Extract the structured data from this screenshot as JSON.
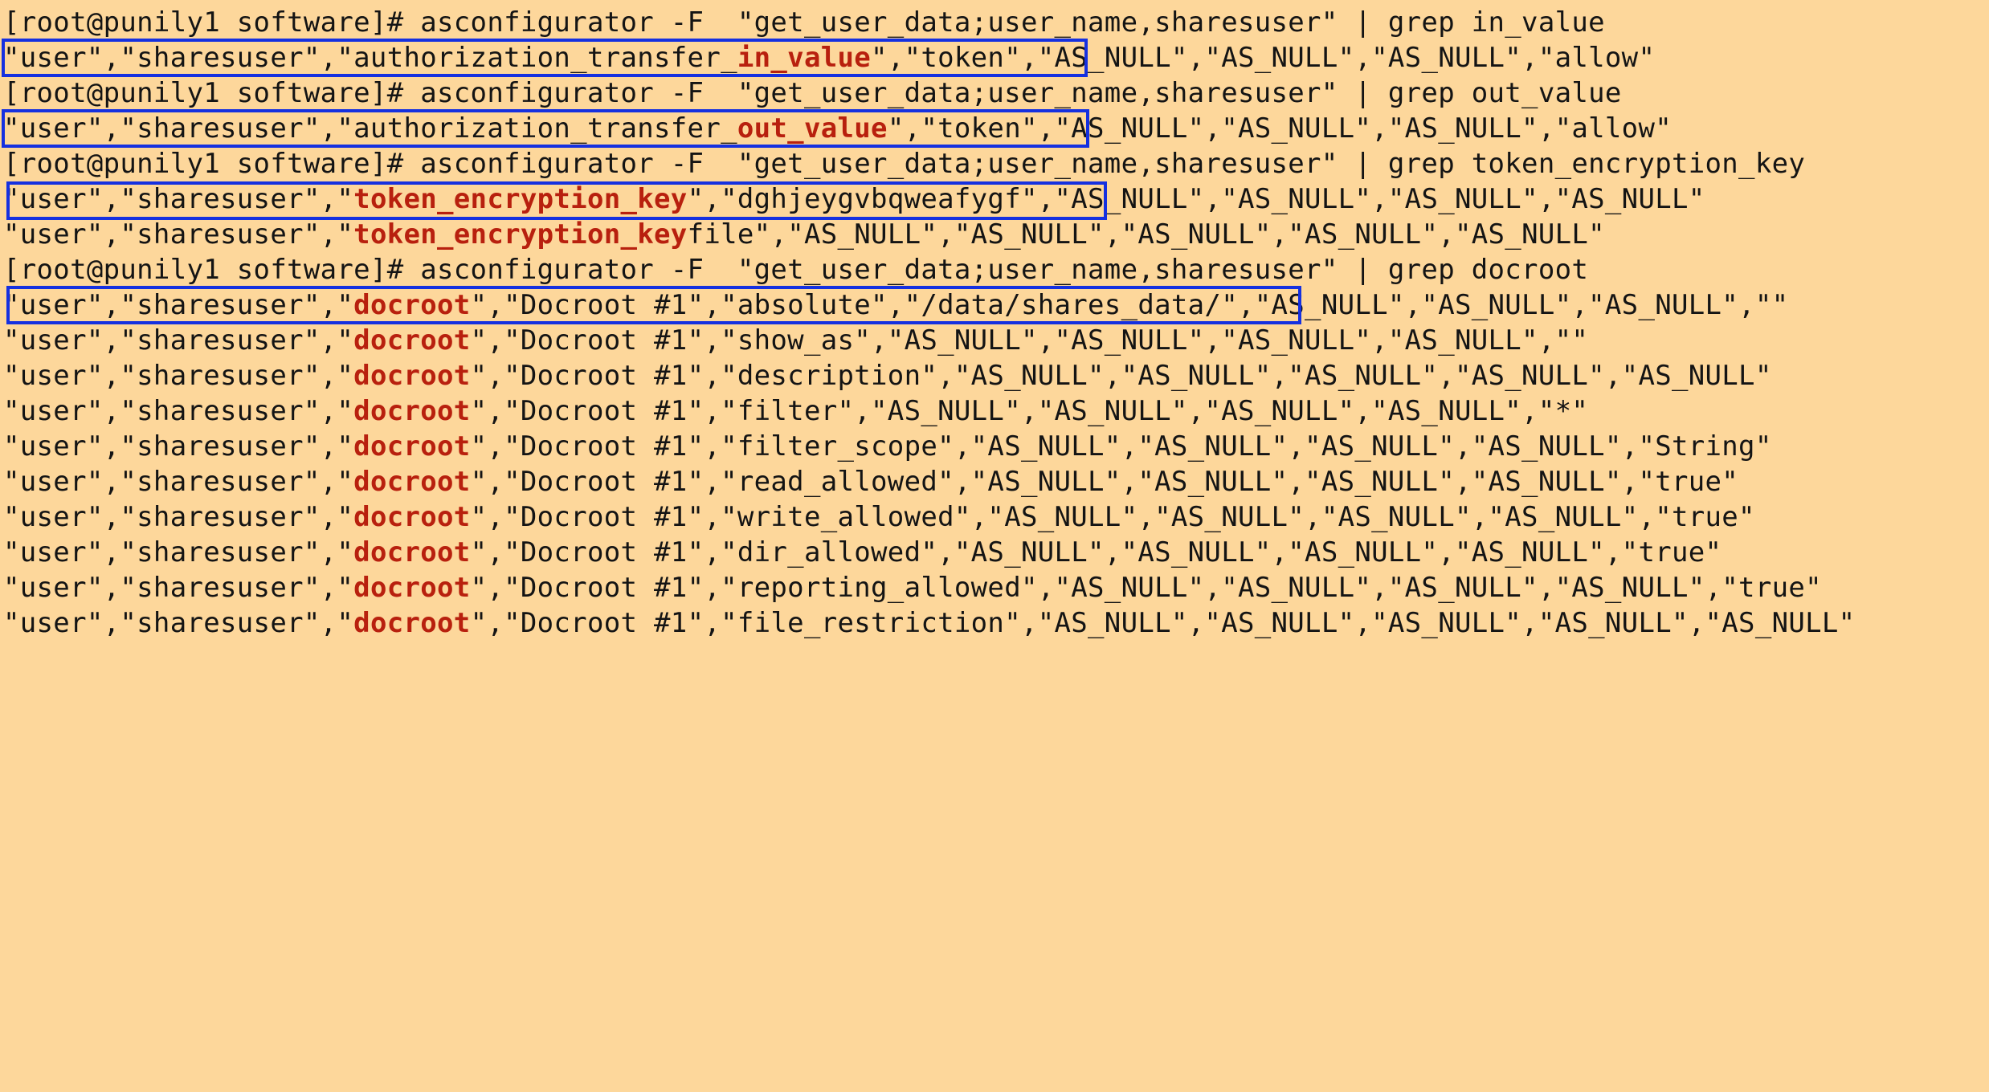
{
  "terminal": {
    "lines": [
      {
        "parts": [
          "[root@punily1 software]# asconfigurator -F  \"get_user_data;user_name,sharesuser\" | grep in_value"
        ]
      },
      {
        "parts": [
          "\"user\",\"sharesuser\",\"authorization_transfer_",
          "in_value",
          "\",\"token\",\"AS_NULL\",\"AS_NULL\",\"AS_NULL\",\"allow\""
        ]
      },
      {
        "parts": [
          "[root@punily1 software]# asconfigurator -F  \"get_user_data;user_name,sharesuser\" | grep out_value"
        ]
      },
      {
        "parts": [
          "\"user\",\"sharesuser\",\"authorization_transfer_",
          "out_value",
          "\",\"token\",\"AS_NULL\",\"AS_NULL\",\"AS_NULL\",\"allow\""
        ]
      },
      {
        "parts": [
          "[root@punily1 software]# asconfigurator -F  \"get_user_data;user_name,sharesuser\" | grep token_encryption_key"
        ]
      },
      {
        "parts": [
          "\"user\",\"sharesuser\",\"",
          "token_encryption_key",
          "\",\"dghjeygvbqweafygf\",\"AS_NULL\",\"AS_NULL\",\"AS_NULL\",\"AS_NULL\""
        ]
      },
      {
        "parts": [
          "\"user\",\"sharesuser\",\"",
          "token_encryption_key",
          "file\",\"AS_NULL\",\"AS_NULL\",\"AS_NULL\",\"AS_NULL\",\"AS_NULL\""
        ]
      },
      {
        "parts": [
          "[root@punily1 software]# asconfigurator -F  \"get_user_data;user_name,sharesuser\" | grep docroot"
        ]
      },
      {
        "parts": [
          "\"user\",\"sharesuser\",\"",
          "docroot",
          "\",\"Docroot #1\",\"absolute\",\"/data/shares_data/\",\"AS_NULL\",\"AS_NULL\",\"AS_NULL\",\"\""
        ]
      },
      {
        "parts": [
          "\"user\",\"sharesuser\",\"",
          "docroot",
          "\",\"Docroot #1\",\"show_as\",\"AS_NULL\",\"AS_NULL\",\"AS_NULL\",\"AS_NULL\",\"\""
        ]
      },
      {
        "parts": [
          "\"user\",\"sharesuser\",\"",
          "docroot",
          "\",\"Docroot #1\",\"description\",\"AS_NULL\",\"AS_NULL\",\"AS_NULL\",\"AS_NULL\",\"AS_NULL\""
        ]
      },
      {
        "parts": [
          "\"user\",\"sharesuser\",\"",
          "docroot",
          "\",\"Docroot #1\",\"filter\",\"AS_NULL\",\"AS_NULL\",\"AS_NULL\",\"AS_NULL\",\"*\""
        ]
      },
      {
        "parts": [
          "\"user\",\"sharesuser\",\"",
          "docroot",
          "\",\"Docroot #1\",\"filter_scope\",\"AS_NULL\",\"AS_NULL\",\"AS_NULL\",\"AS_NULL\",\"String\""
        ]
      },
      {
        "parts": [
          "\"user\",\"sharesuser\",\"",
          "docroot",
          "\",\"Docroot #1\",\"read_allowed\",\"AS_NULL\",\"AS_NULL\",\"AS_NULL\",\"AS_NULL\",\"true\""
        ]
      },
      {
        "parts": [
          "\"user\",\"sharesuser\",\"",
          "docroot",
          "\",\"Docroot #1\",\"write_allowed\",\"AS_NULL\",\"AS_NULL\",\"AS_NULL\",\"AS_NULL\",\"true\""
        ]
      },
      {
        "parts": [
          "\"user\",\"sharesuser\",\"",
          "docroot",
          "\",\"Docroot #1\",\"dir_allowed\",\"AS_NULL\",\"AS_NULL\",\"AS_NULL\",\"AS_NULL\",\"true\""
        ]
      },
      {
        "parts": [
          "\"user\",\"sharesuser\",\"",
          "docroot",
          "\",\"Docroot #1\",\"reporting_allowed\",\"AS_NULL\",\"AS_NULL\",\"AS_NULL\",\"AS_NULL\",\"true\""
        ]
      },
      {
        "parts": [
          "\"user\",\"sharesuser\",\"",
          "docroot",
          "\",\"Docroot #1\",\"file_restriction\",\"AS_NULL\",\"AS_NULL\",\"AS_NULL\",\"AS_NULL\",\"AS_NULL\""
        ]
      }
    ]
  },
  "theme": {
    "background": "#fdd79b",
    "text": "#141414",
    "match_highlight": "#b8200e",
    "annotation_box": "#1530e0"
  }
}
